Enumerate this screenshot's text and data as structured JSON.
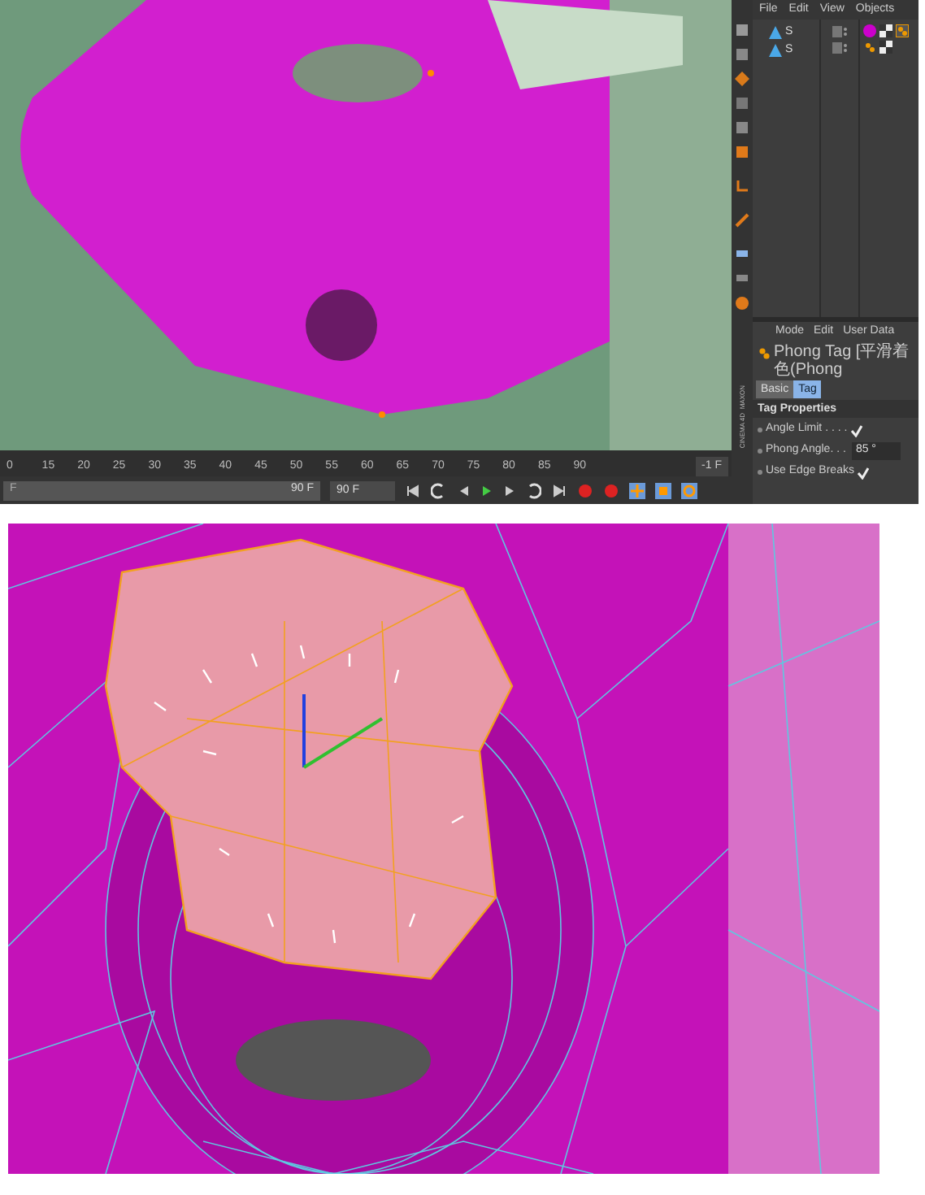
{
  "object_manager": {
    "menu": [
      "File",
      "Edit",
      "View",
      "Objects"
    ],
    "objects": [
      {
        "name": "S"
      },
      {
        "name": "S"
      }
    ]
  },
  "attributes": {
    "menu": [
      "Mode",
      "Edit",
      "User Data"
    ],
    "title": "Phong Tag [平滑着色(Phong",
    "tabs": [
      {
        "label": "Basic",
        "selected": false
      },
      {
        "label": "Tag",
        "selected": true
      }
    ],
    "section": "Tag Properties",
    "properties": [
      {
        "kind": "checkbox",
        "label": "Angle Limit . . . .",
        "checked": true
      },
      {
        "kind": "number",
        "label": "Phong Angle. . .",
        "value": "85 °"
      },
      {
        "kind": "checkbox",
        "label": "Use Edge Breaks",
        "checked": true
      }
    ]
  },
  "logo": [
    "MAXON",
    "CINEMA 4D"
  ],
  "timeline": {
    "ticks": [
      "0",
      "15",
      "20",
      "25",
      "30",
      "35",
      "40",
      "45",
      "50",
      "55",
      "60",
      "65",
      "70",
      "75",
      "80",
      "85",
      "90"
    ],
    "current_frame": "-1 F",
    "range_start": "F",
    "range_end": "90 F",
    "range": {
      "level": 1
    },
    "end_field": "90 F"
  }
}
